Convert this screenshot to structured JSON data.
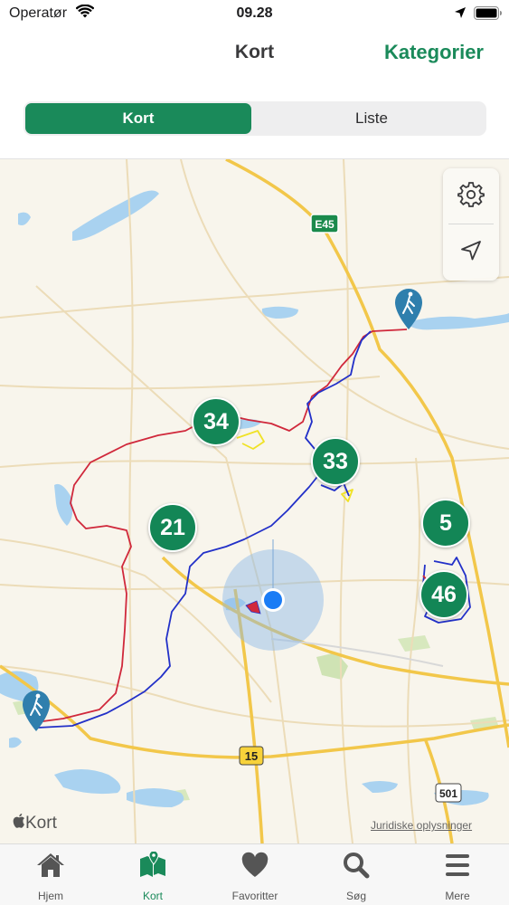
{
  "status_bar": {
    "carrier": "Operatør",
    "time": "09.28"
  },
  "header": {
    "title": "Kort",
    "action_label": "Kategorier"
  },
  "segmented_control": {
    "options": [
      "Kort",
      "Liste"
    ],
    "selected": "Kort"
  },
  "map": {
    "road_labels": [
      "E45",
      "15",
      "501"
    ],
    "clusters": [
      "34",
      "33",
      "21",
      "5",
      "46"
    ],
    "brand": "Kort",
    "legal_link": "Juridiske oplysninger",
    "controls": [
      "settings-icon",
      "location-arrow-icon"
    ]
  },
  "tab_bar": {
    "items": [
      {
        "label": "Hjem",
        "icon": "home-icon"
      },
      {
        "label": "Kort",
        "icon": "map-icon"
      },
      {
        "label": "Favoritter",
        "icon": "heart-icon"
      },
      {
        "label": "Søg",
        "icon": "search-icon"
      },
      {
        "label": "Mere",
        "icon": "menu-icon"
      }
    ],
    "active": "Kort"
  },
  "colors": {
    "accent": "#1a8a5a",
    "cluster": "#138656",
    "trail_red": "#d0283b",
    "trail_blue": "#2230c8",
    "user_location": "#1a7cf5",
    "pin": "#2f7fad"
  }
}
